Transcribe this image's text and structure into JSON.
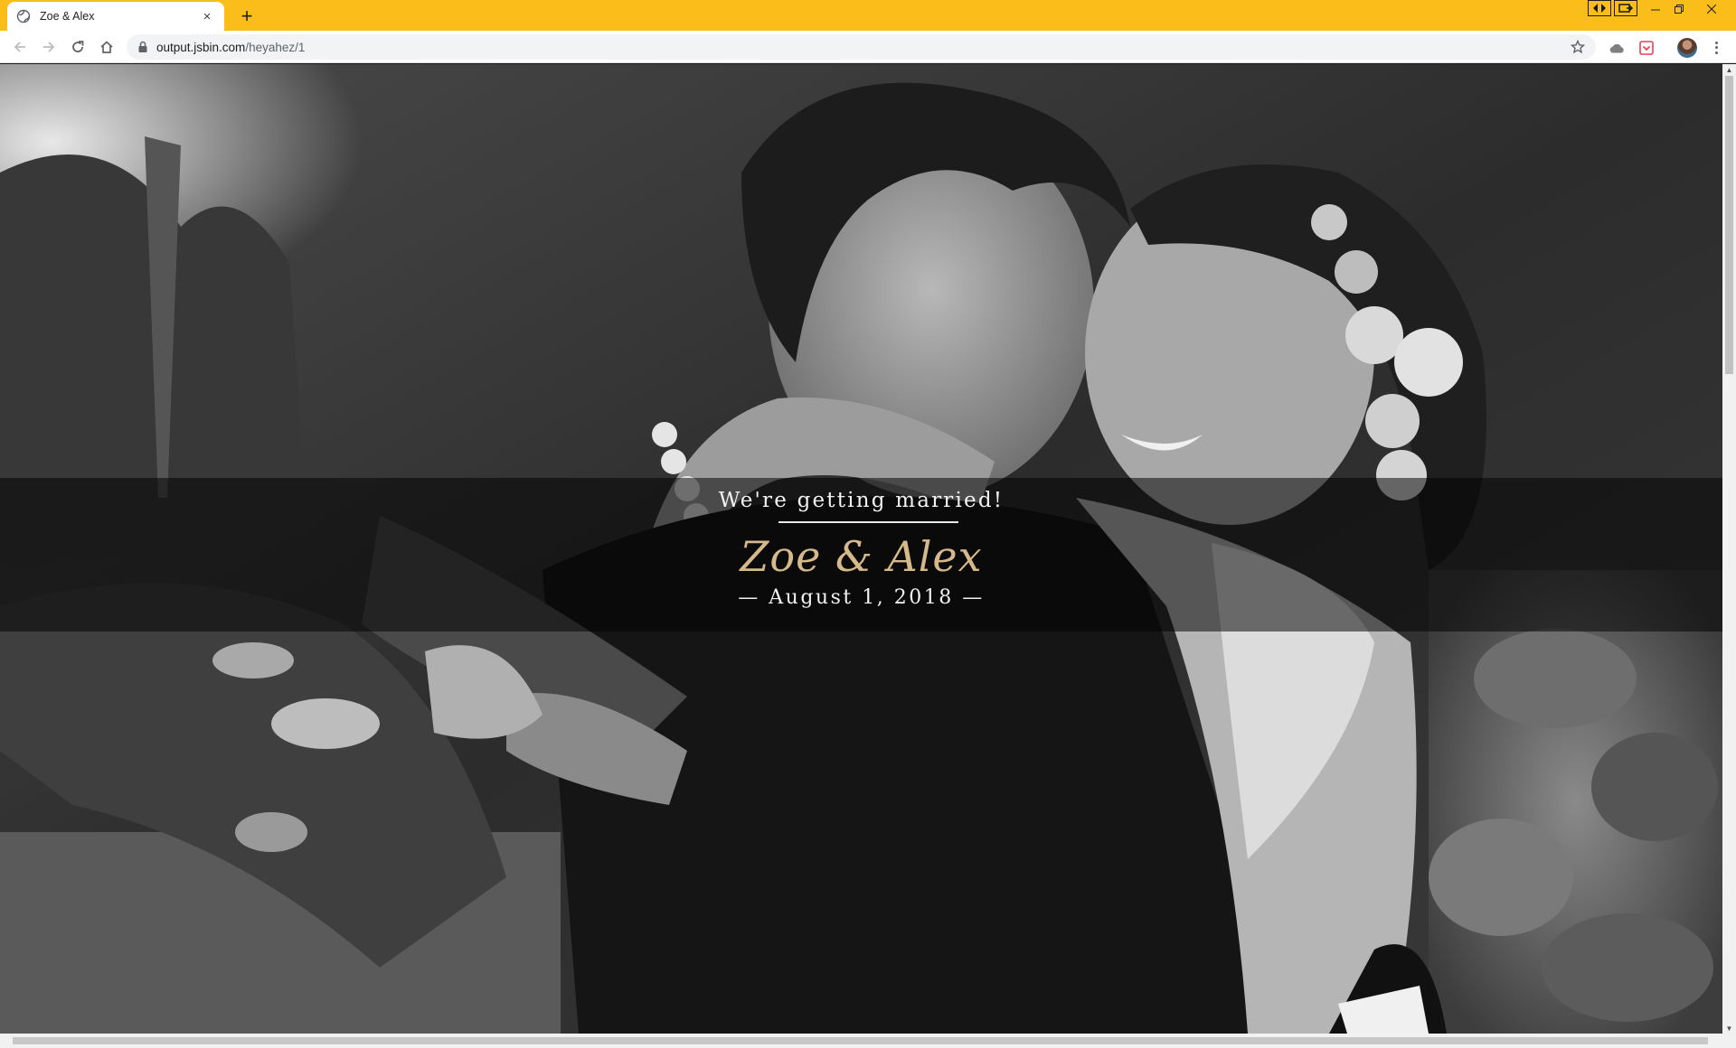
{
  "browser": {
    "tab_title": "Zoe & Alex",
    "tab_close": "×",
    "new_tab": "+",
    "url_host": "output.jsbin.com",
    "url_path": "/heyahez/1"
  },
  "hero": {
    "tagline": "We're getting married!",
    "names": "Zoe & Alex",
    "date": "— August 1, 2018 —"
  },
  "colors": {
    "tabbar": "#fbbd19",
    "names_gold": "#d6b98a",
    "band_overlay": "rgba(0,0,0,0.52)"
  },
  "icons": [
    "globe-icon",
    "back-icon",
    "forward-icon",
    "reload-icon",
    "home-icon",
    "lock-icon",
    "star-icon",
    "cloud-icon",
    "pocket-icon",
    "menu-icon"
  ]
}
